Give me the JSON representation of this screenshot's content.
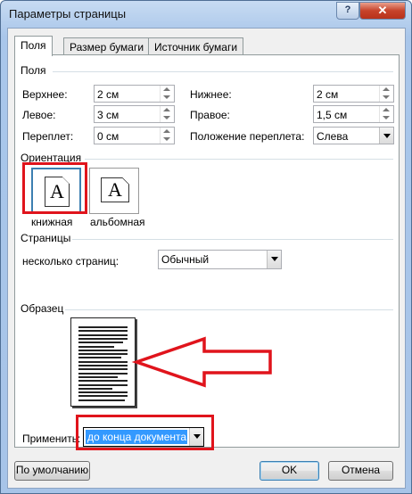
{
  "window": {
    "title": "Параметры страницы",
    "help": "?",
    "close": "✕"
  },
  "tabs": [
    "Поля",
    "Размер бумаги",
    "Источник бумаги"
  ],
  "margins": {
    "group": "Поля",
    "top_label": "Верхнее:",
    "top_value": "2 см",
    "bottom_label": "Нижнее:",
    "bottom_value": "2 см",
    "left_label": "Левое:",
    "left_value": "3 см",
    "right_label": "Правое:",
    "right_value": "1,5 см",
    "gutter_label": "Переплет:",
    "gutter_value": "0 см",
    "gutter_pos_label": "Положение переплета:",
    "gutter_pos_value": "Слева"
  },
  "orientation": {
    "group": "Ориентация",
    "portrait_label": "книжная",
    "landscape_label": "альбомная",
    "glyph": "A"
  },
  "pages": {
    "group": "Страницы",
    "multiple_label": "несколько страниц:",
    "multiple_value": "Обычный"
  },
  "sample": {
    "group": "Образец"
  },
  "apply": {
    "label": "Применить:",
    "value": "до конца документа"
  },
  "buttons": {
    "default": "По умолчанию",
    "ok": "OK",
    "cancel": "Отмена"
  },
  "colors": {
    "highlight": "#e0141c",
    "selection": "#3399ff"
  }
}
